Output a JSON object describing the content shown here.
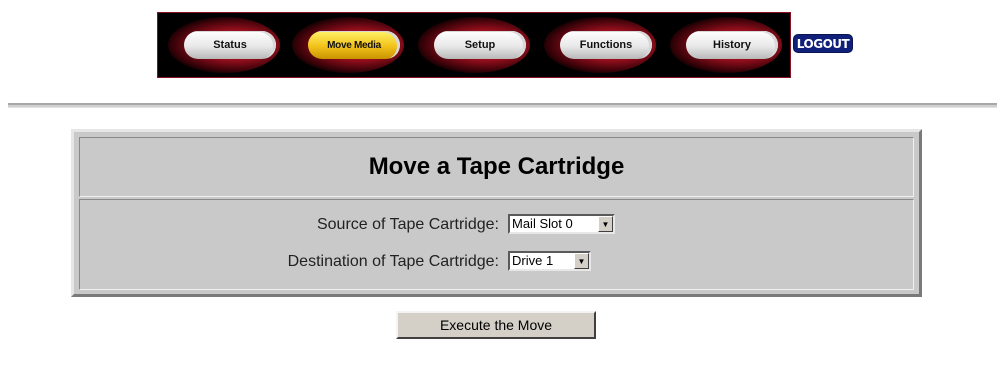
{
  "nav": {
    "items": [
      {
        "label": "Status",
        "active": false
      },
      {
        "label": "Move Media",
        "active": true
      },
      {
        "label": "Setup",
        "active": false
      },
      {
        "label": "Functions",
        "active": false
      },
      {
        "label": "History",
        "active": false
      }
    ],
    "logout_label": "LOGOUT"
  },
  "panel": {
    "title": "Move a Tape Cartridge",
    "source_label": "Source of Tape Cartridge:",
    "source_value": "Mail Slot 0",
    "destination_label": "Destination of Tape Cartridge:",
    "destination_value": "Drive 1"
  },
  "execute_label": "Execute the Move",
  "colors": {
    "active_tab": "#f2c21a",
    "logout_bg": "#10207a",
    "panel_bg": "#c9c9c9"
  }
}
